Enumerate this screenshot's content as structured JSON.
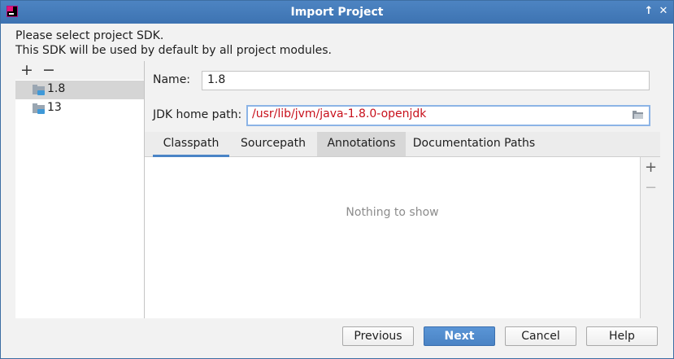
{
  "window": {
    "title": "Import Project"
  },
  "intro": {
    "line1": "Please select project SDK.",
    "line2": "This SDK will be used by default by all project modules."
  },
  "sdk_list": {
    "add_symbol": "+",
    "remove_symbol": "−",
    "items": [
      {
        "label": "1.8",
        "selected": true,
        "icon": "jdk-folder-icon"
      },
      {
        "label": "13",
        "selected": false,
        "icon": "jdk-folder-icon"
      }
    ]
  },
  "form": {
    "name_label": "Name:",
    "name_value": "1.8",
    "jdk_path_label": "JDK home path:",
    "jdk_path_value": "/usr/lib/jvm/java-1.8.0-openjdk",
    "jdk_path_color": "#c8101b"
  },
  "tabs": [
    {
      "label": "Classpath",
      "active": true
    },
    {
      "label": "Sourcepath",
      "active": false
    },
    {
      "label": "Annotations",
      "active": false,
      "hovered": true
    },
    {
      "label": "Documentation Paths",
      "active": false
    }
  ],
  "content": {
    "empty_text": "Nothing to show"
  },
  "side_tools": {
    "add_symbol": "+",
    "remove_symbol": "−"
  },
  "buttons": {
    "previous": "Previous",
    "next": "Next",
    "cancel": "Cancel",
    "help": "Help"
  },
  "colors": {
    "titlebar": "#4a80bf",
    "accent": "#4a84c6",
    "error_text": "#c8101b"
  }
}
